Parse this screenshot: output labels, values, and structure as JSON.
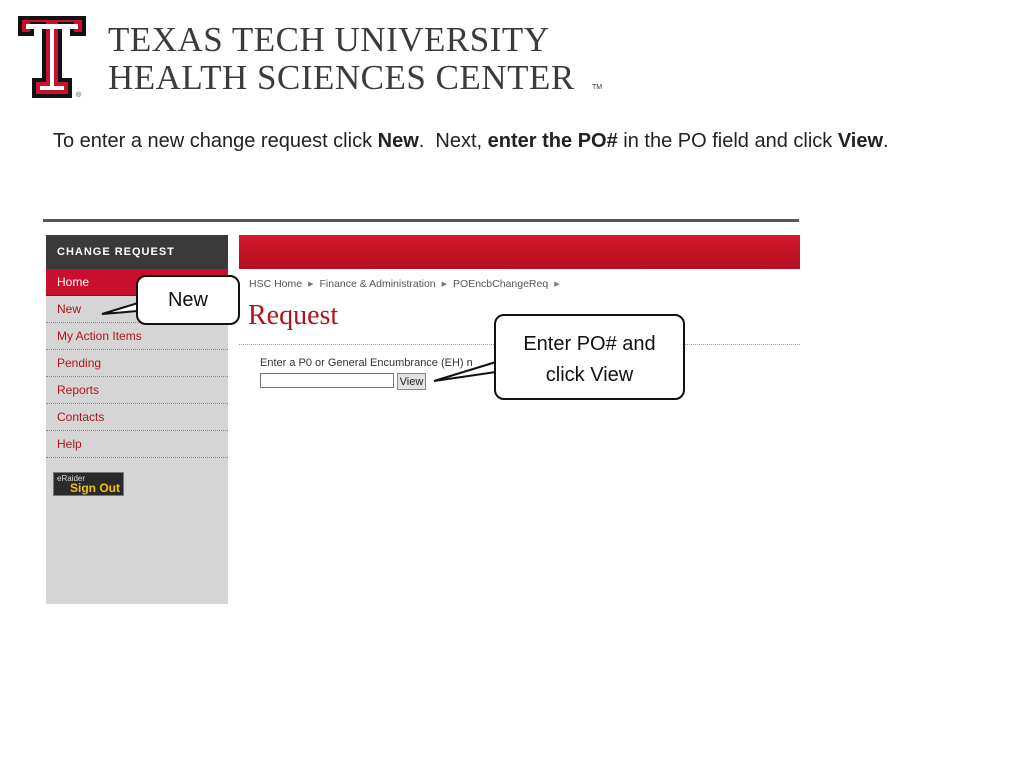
{
  "header": {
    "university_line1": "TEXAS TECH UNIVERSITY",
    "university_line2": "HEALTH SCIENCES CENTER",
    "trademark": "TM",
    "logo_registered": "®",
    "logo_icon": "double-t-logo-icon",
    "brand_red": "#c8102e"
  },
  "instructions": {
    "part1": "To enter a new change request click ",
    "new_bold": "New",
    "part2": ".  Next, ",
    "enter_po_bold": "enter the PO#",
    "part3": " in the PO field and click ",
    "view_bold": "View",
    "part4": "."
  },
  "sidebar": {
    "title": "CHANGE REQUEST",
    "items": [
      {
        "label": "Home",
        "active": true
      },
      {
        "label": "New",
        "active": false
      },
      {
        "label": "My Action Items",
        "active": false
      },
      {
        "label": "Pending",
        "active": false
      },
      {
        "label": "Reports",
        "active": false
      },
      {
        "label": "Contacts",
        "active": false
      },
      {
        "label": "Help",
        "active": false
      }
    ],
    "signout": {
      "brand": "eRaider",
      "label": "Sign Out"
    }
  },
  "breadcrumb": {
    "items": [
      "HSC Home",
      "Finance & Administration",
      "POEncbChangeReq"
    ],
    "separator_icon": "triangle-right-icon"
  },
  "main": {
    "page_title": "Request",
    "field_label": "Enter a P0 or General Encumbrance (EH) n",
    "po_input_value": "",
    "view_button_label": "View"
  },
  "callouts": {
    "new": "New",
    "po_line1": "Enter PO# and",
    "po_line2": "click View"
  }
}
